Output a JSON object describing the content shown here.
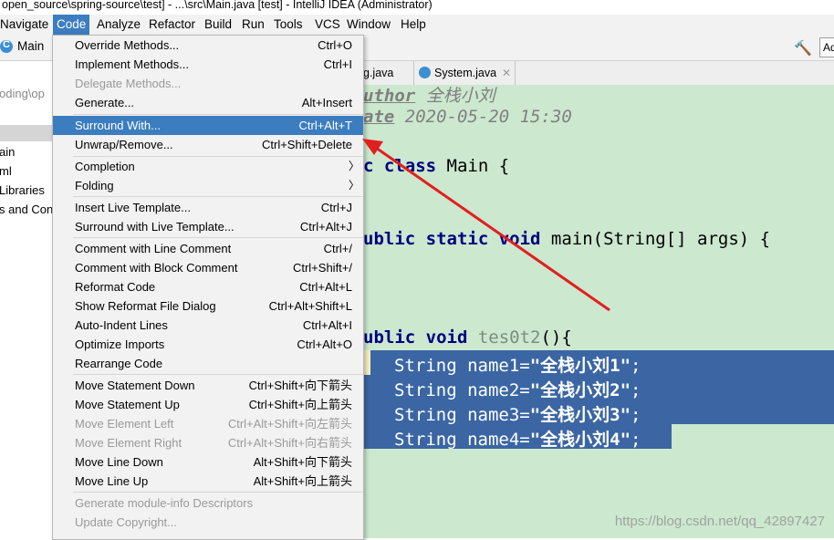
{
  "window": {
    "title": "open_source\\spring-source\\test] - ...\\src\\Main.java [test] - IntelliJ IDEA (Administrator)"
  },
  "menubar": {
    "items": [
      "Navigate",
      "Code",
      "Analyze",
      "Refactor",
      "Build",
      "Run",
      "Tools",
      "VCS",
      "Window",
      "Help"
    ],
    "active": "Code"
  },
  "navbar": {
    "run_config": "Main",
    "right_button": "Ad"
  },
  "left_panel": {
    "path": "oding\\op",
    "items": [
      "ain",
      "ml",
      "Libraries",
      "s and Con"
    ]
  },
  "tabs": [
    {
      "label": "g.java"
    },
    {
      "label": "System.java"
    }
  ],
  "editor": {
    "lines": {
      "author_tag": "uthor",
      "author_value": " 全栈小刘",
      "date_tag": "ate",
      "date_value": " 2020-05-20 15:30",
      "class_kw": "c class",
      "class_name": " Main {",
      "main_kw": "ublic static void",
      "main_rest": " main(String[] args) {",
      "test_kw": "ublic void",
      "test_name": " tes0t2",
      "test_rest": "(){",
      "s1_type": "String name1=",
      "s1_val": "\"全栈小刘1\"",
      "s2_type": "String name2=",
      "s2_val": "\"全栈小刘2\"",
      "s3_type": "String name3=",
      "s3_val": "\"全栈小刘3\"",
      "s4_type": "String name4=",
      "s4_val": "\"全栈小刘4\"",
      "semi": ";"
    }
  },
  "code_menu": {
    "items": [
      {
        "label": "Override Methods...",
        "shortcut": "Ctrl+O",
        "disabled": false
      },
      {
        "label": "Implement Methods...",
        "shortcut": "Ctrl+I",
        "disabled": false
      },
      {
        "label": "Delegate Methods...",
        "shortcut": "",
        "disabled": true
      },
      {
        "label": "Generate...",
        "shortcut": "Alt+Insert",
        "disabled": false
      },
      {
        "label": "Surround With...",
        "shortcut": "Ctrl+Alt+T",
        "disabled": false,
        "highlighted": true
      },
      {
        "label": "Unwrap/Remove...",
        "shortcut": "Ctrl+Shift+Delete",
        "disabled": false
      },
      {
        "label": "Completion",
        "shortcut": "",
        "submenu": true
      },
      {
        "label": "Folding",
        "shortcut": "",
        "submenu": true
      },
      {
        "label": "Insert Live Template...",
        "shortcut": "Ctrl+J"
      },
      {
        "label": "Surround with Live Template...",
        "shortcut": "Ctrl+Alt+J"
      },
      {
        "label": "Comment with Line Comment",
        "shortcut": "Ctrl+/"
      },
      {
        "label": "Comment with Block Comment",
        "shortcut": "Ctrl+Shift+/"
      },
      {
        "label": "Reformat Code",
        "shortcut": "Ctrl+Alt+L"
      },
      {
        "label": "Show Reformat File Dialog",
        "shortcut": "Ctrl+Alt+Shift+L"
      },
      {
        "label": "Auto-Indent Lines",
        "shortcut": "Ctrl+Alt+I"
      },
      {
        "label": "Optimize Imports",
        "shortcut": "Ctrl+Alt+O"
      },
      {
        "label": "Rearrange Code",
        "shortcut": ""
      },
      {
        "label": "Move Statement Down",
        "shortcut": "Ctrl+Shift+向下箭头"
      },
      {
        "label": "Move Statement Up",
        "shortcut": "Ctrl+Shift+向上箭头"
      },
      {
        "label": "Move Element Left",
        "shortcut": "Ctrl+Alt+Shift+向左箭头",
        "disabled": true
      },
      {
        "label": "Move Element Right",
        "shortcut": "Ctrl+Alt+Shift+向右箭头",
        "disabled": true
      },
      {
        "label": "Move Line Down",
        "shortcut": "Alt+Shift+向下箭头"
      },
      {
        "label": "Move Line Up",
        "shortcut": "Alt+Shift+向上箭头"
      },
      {
        "label": "Generate module-info Descriptors",
        "shortcut": "",
        "disabled": true
      },
      {
        "label": "Update Copyright...",
        "shortcut": "",
        "disabled": true
      }
    ]
  },
  "watermark": "https://blog.csdn.net/qq_42897427",
  "colors": {
    "menu_highlight": "#3c7dbf",
    "editor_bg": "#cce8cf",
    "selection": "#2f5aa0",
    "annotation_arrow": "#e02020"
  }
}
